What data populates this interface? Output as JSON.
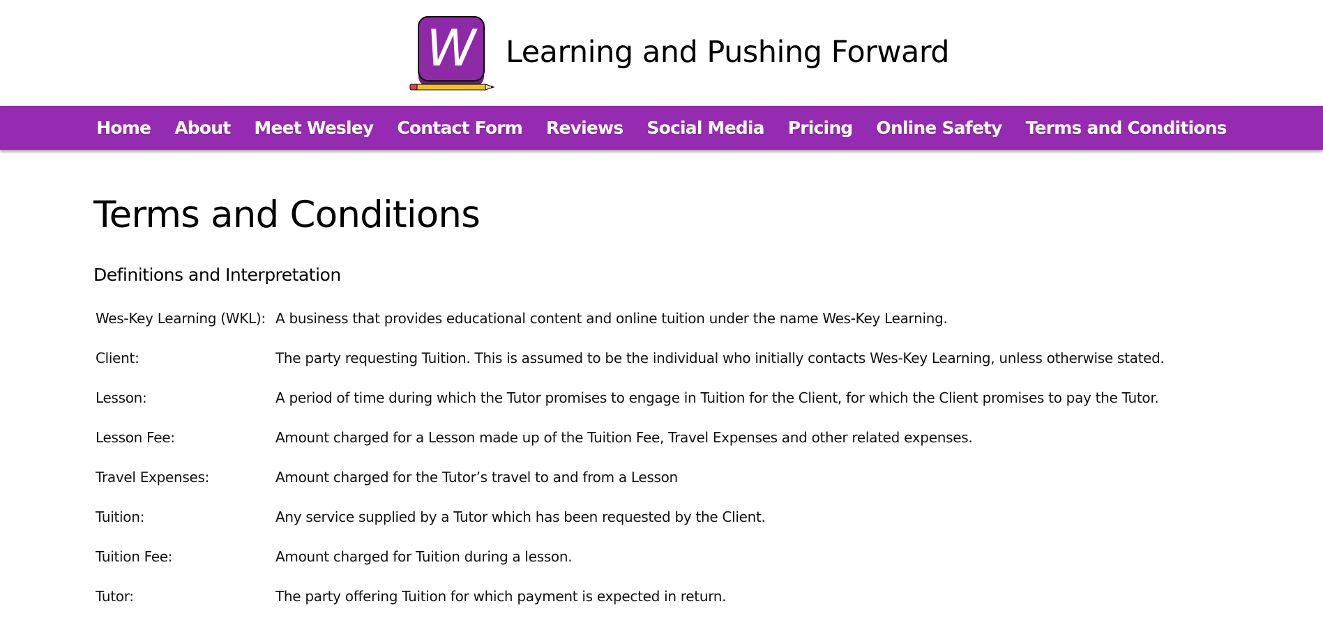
{
  "header": {
    "logo_letter": "W",
    "site_title": "Learning and Pushing Forward"
  },
  "nav": {
    "items": [
      {
        "label": "Home"
      },
      {
        "label": "About"
      },
      {
        "label": "Meet Wesley"
      },
      {
        "label": "Contact Form"
      },
      {
        "label": "Reviews"
      },
      {
        "label": "Social Media"
      },
      {
        "label": "Pricing"
      },
      {
        "label": "Online Safety"
      },
      {
        "label": "Terms and Conditions"
      }
    ]
  },
  "main": {
    "page_title": "Terms and Conditions",
    "section_heading": "Definitions and Interpretation",
    "definitions": [
      {
        "term": "Wes-Key Learning (WKL):",
        "definition": "A business that provides educational content and online tuition under the name Wes-Key Learning."
      },
      {
        "term": "Client:",
        "definition": "The party requesting Tuition. This is assumed to be the individual who initially contacts Wes-Key Learning, unless otherwise stated."
      },
      {
        "term": "Lesson:",
        "definition": "A period of time during which the Tutor promises to engage in Tuition for the Client, for which the Client promises to pay the Tutor."
      },
      {
        "term": "Lesson Fee:",
        "definition": "Amount charged for a Lesson made up of the Tuition Fee, Travel Expenses and other related expenses."
      },
      {
        "term": "Travel Expenses:",
        "definition": "Amount charged for the Tutor’s travel to and from a Lesson"
      },
      {
        "term": "Tuition:",
        "definition": "Any service supplied by a Tutor which has been requested by the Client."
      },
      {
        "term": "Tuition Fee:",
        "definition": "Amount charged for Tuition during a lesson."
      },
      {
        "term": "Tutor:",
        "definition": "The party offering Tuition for which payment is expected in return."
      }
    ]
  },
  "colors": {
    "brand_purple": "#952bb0",
    "logo_purple": "#8e2aa8",
    "pencil_yellow": "#f2c417"
  }
}
